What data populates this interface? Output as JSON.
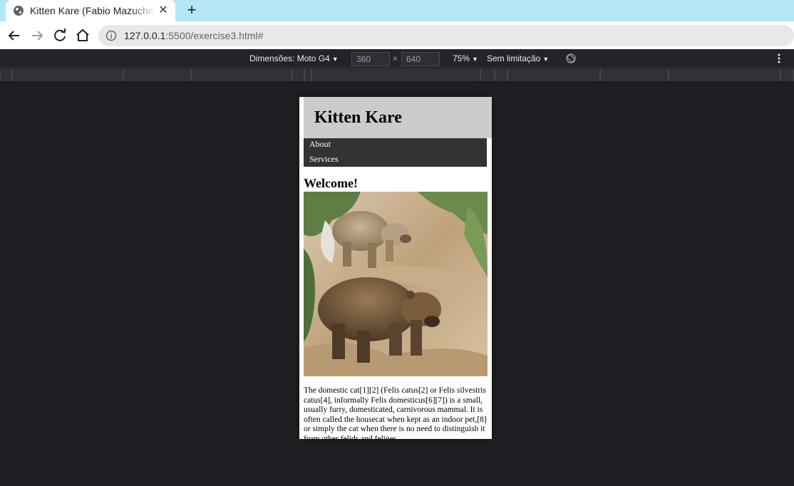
{
  "browser": {
    "tab_title": "Kitten Kare (Fabio Mazucheli)",
    "url_host": "127.0.0.1",
    "url_rest": ":5500/exercise3.html#"
  },
  "devtools": {
    "device_label": "Dimensões: Moto G4",
    "width": "360",
    "height": "640",
    "times": "×",
    "zoom": "75%",
    "throttle": "Sem limitação"
  },
  "site": {
    "title": "Kitten Kare",
    "nav": [
      "About",
      "Services"
    ],
    "heading": "Welcome!",
    "paragraph": "The domestic cat[1][2] (Felis catus[2] or Felis silvestris catus[4], informally Felis domesticus[6][7]) is a small, usually furry, domesticated, carnivorous mammal. It is often called the housecat when kept as an indoor pet,[8] or simply the cat when there is no need to distinguish it from other felids and felines."
  },
  "colors": {
    "tabstrip": "#b4e7f3",
    "header": "#cccccc",
    "nav": "#333333",
    "devtools_bg": "#1f1f23"
  },
  "icons": [
    "globe-icon",
    "close-icon",
    "plus-icon",
    "back-arrow-icon",
    "forward-arrow-icon",
    "reload-icon",
    "home-icon",
    "info-icon",
    "rotate-icon",
    "more-icon"
  ]
}
